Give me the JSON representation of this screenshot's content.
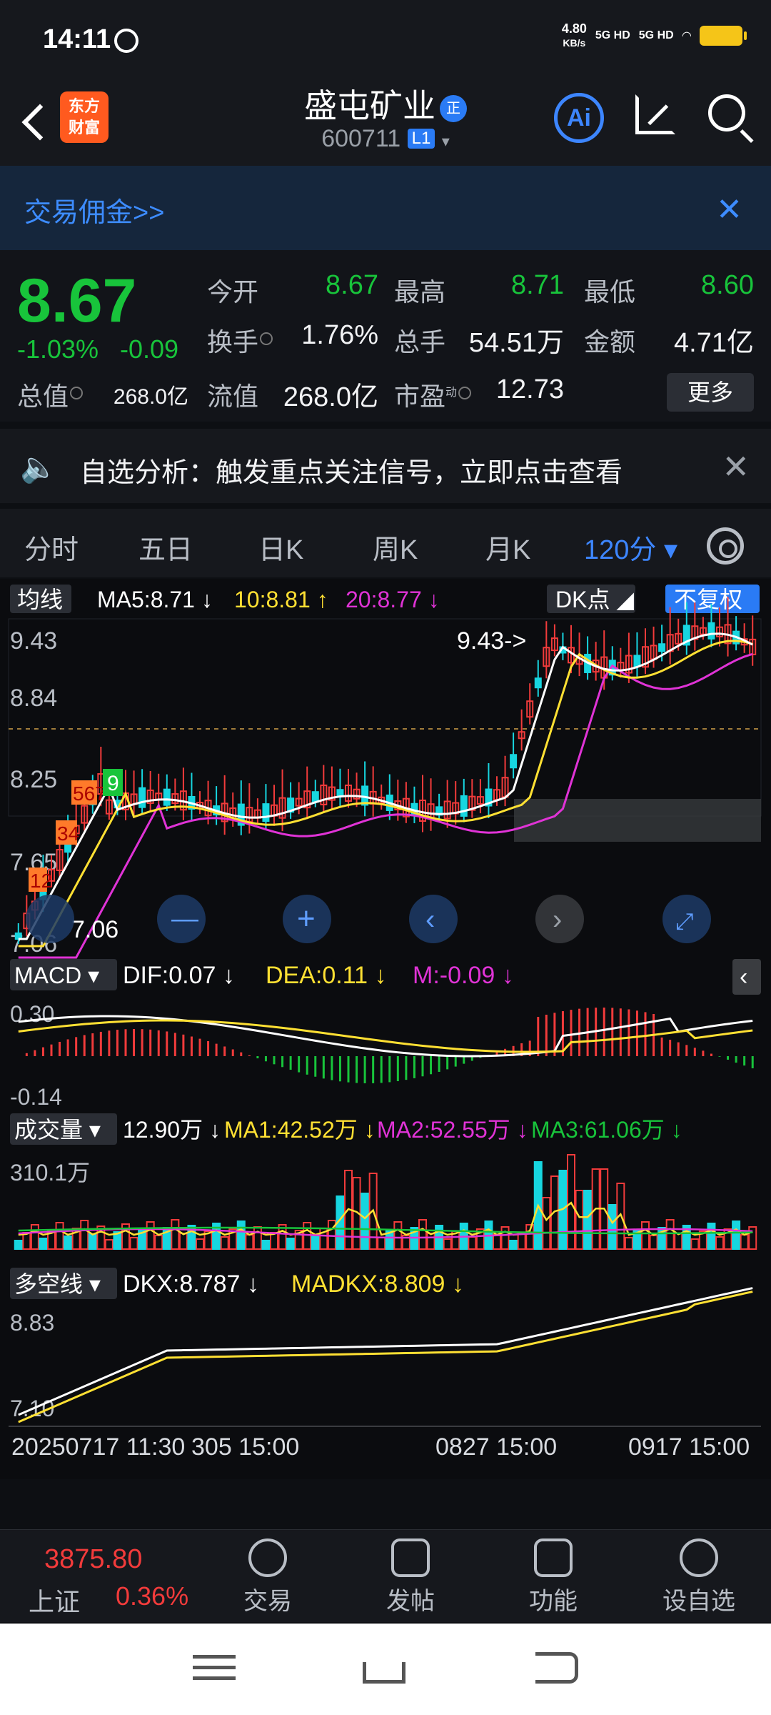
{
  "status": {
    "time": "14:11",
    "net_speed": "4.80",
    "net_unit": "KB/s",
    "sig1": "5G HD",
    "sig2": "5G HD"
  },
  "header": {
    "logo_line1": "东方",
    "logo_line2": "财富",
    "stock_name": "盛屯矿业",
    "reg_badge": "正",
    "stock_code": "600711",
    "level": "L1",
    "ai_label": "Ai"
  },
  "promo": {
    "text": "交易佣金>>",
    "close": "✕"
  },
  "quote": {
    "price": "8.67",
    "change_pct": "-1.03%",
    "change_abs": "-0.09",
    "open_label": "今开",
    "open": "8.67",
    "high_label": "最高",
    "high": "8.71",
    "low_label": "最低",
    "low": "8.60",
    "turnover_label": "换手",
    "turnover": "1.76%",
    "volume_label": "总手",
    "volume": "54.51万",
    "amount_label": "金额",
    "amount": "4.71亿",
    "mktcap_label": "总值",
    "mktcap": "268.0亿",
    "float_label": "流值",
    "float_cap": "268.0亿",
    "pe_label": "市盈",
    "pe_sup": "动",
    "pe": "12.73",
    "more": "更多"
  },
  "alert": {
    "text": "自选分析：触发重点关注信号，立即点击查看",
    "close": "✕"
  },
  "tabs": [
    {
      "label": "分时"
    },
    {
      "label": "五日"
    },
    {
      "label": "日K"
    },
    {
      "label": "周K"
    },
    {
      "label": "月K"
    },
    {
      "label": "120分 ▾"
    }
  ],
  "ma_bar": {
    "tag": "均线",
    "ma5": "MA5:8.71 ↓",
    "ma10": "10:8.81 ↑",
    "ma20": "20:8.77 ↓",
    "dk": "DK点 ◢",
    "fq": "不复权"
  },
  "price_axis": {
    "p1": "9.43",
    "p2": "8.84",
    "p3": "8.25",
    "p4": "7.65",
    "p5": "7.06"
  },
  "annotations": {
    "high_mark": "9.43->",
    "low_mark": "7.06"
  },
  "macd": {
    "tag": "MACD ▾",
    "dif": "DIF:0.07 ↓",
    "dea": "DEA:0.11 ↓",
    "m": "M:-0.09 ↓",
    "axis_top": "0.30",
    "axis_bot": "-0.14"
  },
  "vol": {
    "tag": "成交量 ▾",
    "cur": "12.90万 ↓",
    "ma1": "MA1:42.52万 ↓",
    "ma2": "MA2:52.55万 ↓",
    "ma3": "MA3:61.06万 ↓",
    "axis_top": "310.1万"
  },
  "dkx": {
    "tag": "多空线 ▾",
    "dkx": "DKX:8.787 ↓",
    "madkx": "MADKX:8.809 ↓",
    "axis_top": "8.83",
    "axis_bot": "7.10"
  },
  "time_axis": {
    "t1": "20250717 11:30",
    "t1b": "305 15:00",
    "t2": "0827 15:00",
    "t3": "0917 15:00"
  },
  "bottom_nav": {
    "index_val": "3875.80",
    "index_name": "上证",
    "index_chg": "0.36%",
    "items": [
      {
        "label": "交易"
      },
      {
        "label": "发帖"
      },
      {
        "label": "功能"
      },
      {
        "label": "设自选"
      }
    ]
  },
  "colors": {
    "up": "#f23b3b",
    "down": "#18c43b",
    "cyan_candle": "#17d6e0",
    "ma5": "#ffffff",
    "ma10": "#ffe033",
    "ma20": "#e033d6",
    "accent": "#3d86ff"
  }
}
